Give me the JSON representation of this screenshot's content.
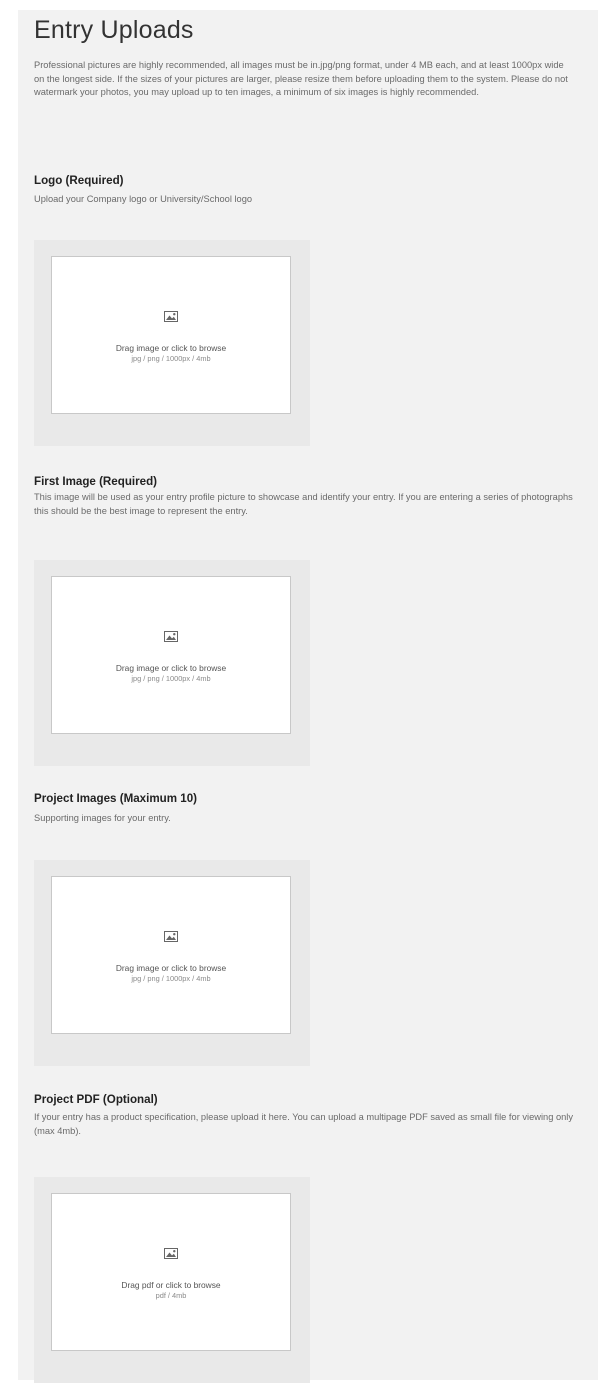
{
  "page": {
    "title": "Entry Uploads",
    "intro": "Professional pictures are highly recommended, all images must be in.jpg/png format, under 4 MB each, and at least 1000px wide on the longest side. If the sizes of your pictures are larger, please resize them before uploading them to the system. Please do not watermark your photos, you may upload up to ten images, a minimum of six images is highly recommended."
  },
  "sections": [
    {
      "title": "Logo (Required)",
      "description": "Upload your Company logo or University/School logo",
      "dropzone": {
        "icon": "image-icon",
        "label": "Drag image or click to browse",
        "hint": "jpg / png / 1000px / 4mb"
      }
    },
    {
      "title": "First Image (Required)",
      "description": "This image will be used as your entry profile picture to showcase and identify your entry. If you are entering a series of photographs this should be the best image to represent the entry.",
      "dropzone": {
        "icon": "image-icon",
        "label": "Drag image or click to browse",
        "hint": "jpg / png / 1000px / 4mb"
      }
    },
    {
      "title": "Project Images (Maximum 10)",
      "description": "Supporting images for your entry.",
      "dropzone": {
        "icon": "image-icon",
        "label": "Drag image or click to browse",
        "hint": "jpg / png / 1000px / 4mb"
      }
    },
    {
      "title": "Project PDF (Optional)",
      "description": "If your entry has a product specification, please upload it here. You can upload a multipage PDF saved as small file for viewing only (max 4mb).",
      "dropzone": {
        "icon": "image-icon",
        "label": "Drag pdf or click to browse",
        "hint": "pdf / 4mb"
      }
    }
  ]
}
